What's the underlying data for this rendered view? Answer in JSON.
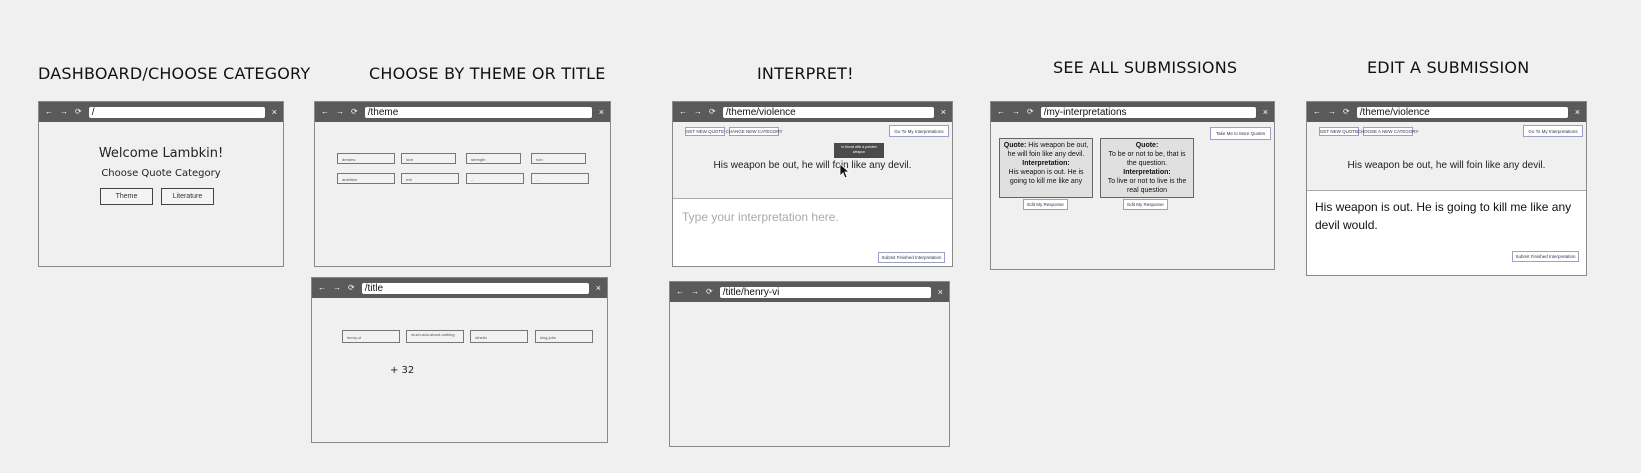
{
  "columns": [
    {
      "title": "DASHBOARD/CHOOSE CATEGORY"
    },
    {
      "title": "CHOOSE BY THEME OR TITLE"
    },
    {
      "title": "INTERPRET!"
    },
    {
      "title": "SEE ALL SUBMISSIONS"
    },
    {
      "title": "EDIT A SUBMISSION"
    }
  ],
  "browser_icons": {
    "back": "←",
    "forward": "→",
    "reload": "⟳",
    "close": "×"
  },
  "dashboard": {
    "url": "/",
    "welcome": "Welcome Lambkin!",
    "prompt": "Choose Quote Category",
    "buttons": [
      "Theme",
      "Literature"
    ]
  },
  "theme_page": {
    "url": "/theme",
    "chips": [
      "dreams",
      "love",
      "strength",
      "ruin",
      "ambition",
      "evil",
      "...",
      "..."
    ]
  },
  "title_page": {
    "url": "/title",
    "chips": [
      "henry-vi",
      "much-ado-about-nothing",
      "othello",
      "king-john"
    ],
    "more": "+ 32"
  },
  "interpret_theme": {
    "url": "/theme/violence",
    "top_buttons": [
      "GET NEW QUOTE",
      "CHANGE NEW CATEGORY"
    ],
    "go_button": "Go To My Interpretations",
    "tooltip": "to thrust with a pointed weapon",
    "quote": "His weapon be out, he will foin like any devil.",
    "placeholder": "Type your interpretation here.",
    "submit": "Submit Finished Interpretation"
  },
  "interpret_title": {
    "url": "/title/henry-vi"
  },
  "submissions": {
    "url": "/my-interpretations",
    "button": "Take Me to More Quotes",
    "cards": [
      {
        "quote_label": "Quote:",
        "quote": "His weapon be out, he will foin like any devil.",
        "interp_label": "Interpretation:",
        "interp": "His weapon is out. He is going to kill me like any",
        "edit": "Edit My Response"
      },
      {
        "quote_label": "Quote:",
        "quote": "To be or not to be, that is the question.",
        "interp_label": "Interpretation:",
        "interp": "To live or not to live is the real question",
        "edit": "Edit My Response"
      }
    ]
  },
  "edit_page": {
    "url": "/theme/violence",
    "top_buttons": [
      "GET NEW QUOTE",
      "CHOOSE A NEW CATEGORY"
    ],
    "go_button": "Go To My Interpretations",
    "quote": "His weapon be out, he will foin like any devil.",
    "text": "His weapon is out. He is going to kill me like any devil would.",
    "submit": "Submit Finished Interpretation"
  }
}
